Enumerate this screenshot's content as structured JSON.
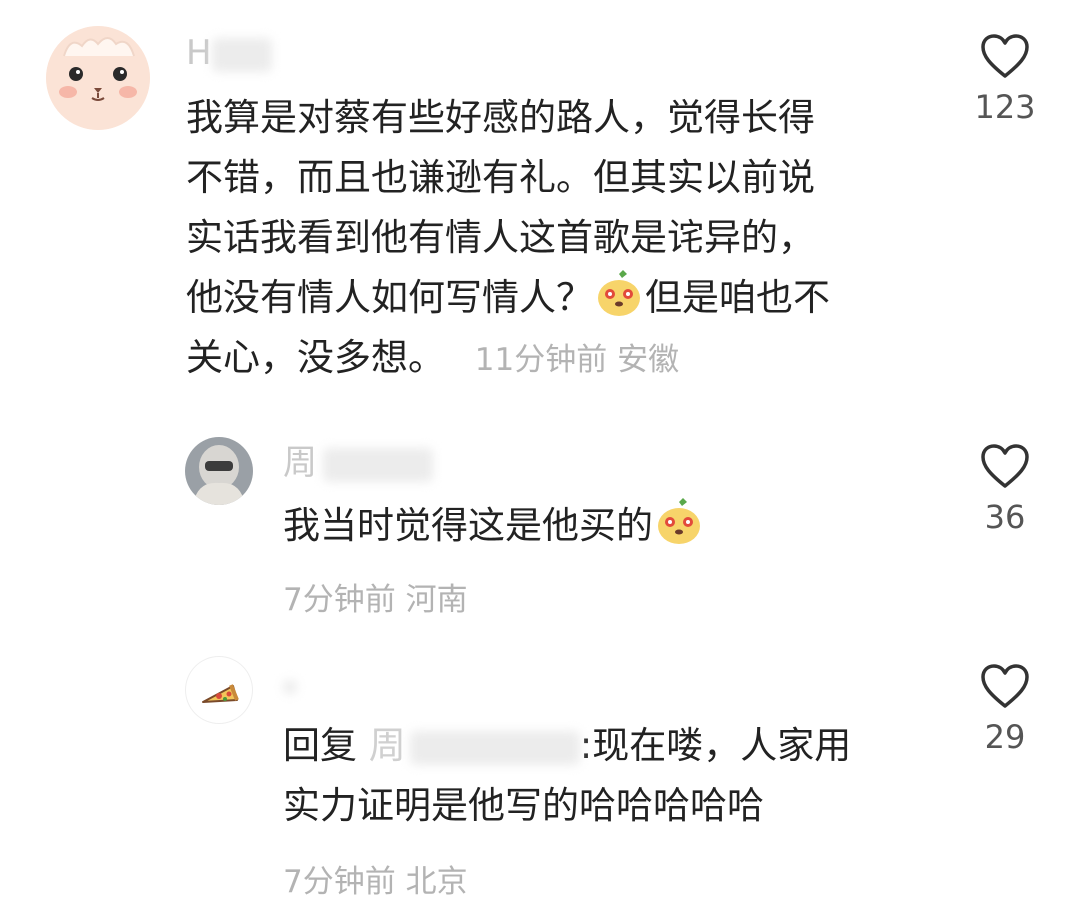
{
  "comments": [
    {
      "username": "H",
      "avatar_icon": "bunny-bear-avatar-icon",
      "text_lines": [
        "我算是对蔡有些好感的路人，觉得长得",
        "不错，而且也谦逊有礼。但其实以前说",
        "实话我看到他有情人这首歌是诧异的，"
      ],
      "line4_a": "他没有情人如何写情人？",
      "line4_b": "但是咱也不",
      "line5": "关心，没多想。",
      "time": "11分钟前",
      "location": "安徽",
      "likes": "123"
    },
    {
      "username": "周",
      "avatar_icon": "person-avatar-icon",
      "text": "我当时觉得这是他买的",
      "time": "7分钟前",
      "location": "河南",
      "likes": "36"
    },
    {
      "username": "",
      "avatar_icon": "pizza-avatar-icon",
      "reply_prefix": "回复",
      "reply_to": "周",
      "reply_line1": ":现在喽，人家用",
      "reply_line2": "实力证明是他写的哈哈哈哈哈",
      "time": "7分钟前",
      "location": "北京",
      "likes": "29"
    }
  ],
  "icons": {
    "like": "heart-outline-icon",
    "emoji": "mango-face-emoji-icon"
  },
  "colors": {
    "text": "#222222",
    "meta": "#b3b3b3",
    "username": "#c9c9c9",
    "like_count": "#555555"
  }
}
